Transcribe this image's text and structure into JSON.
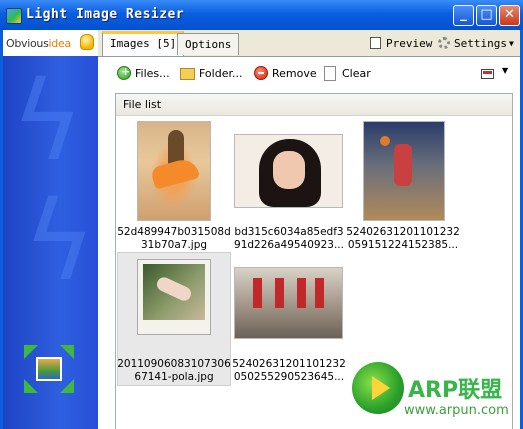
{
  "window": {
    "title": "Light Image Resizer"
  },
  "logo": {
    "text_main": "Obvious",
    "text_accent": "idea"
  },
  "tabs": [
    {
      "label": "Images [5]",
      "active": true
    },
    {
      "label": "Options",
      "active": false
    }
  ],
  "header_links": {
    "preview": "Preview",
    "settings": "Settings"
  },
  "toolbar": {
    "add_files": "Files...",
    "add_folder": "Folder...",
    "remove": "Remove",
    "clear": "Clear"
  },
  "file_list": {
    "title": "File list",
    "items": [
      {
        "line1": "52d489947b031508d",
        "line2": "31b70a7.jpg",
        "selected": false
      },
      {
        "line1": "bd315c6034a85edf3",
        "line2": "91d226a49540923...",
        "selected": false
      },
      {
        "line1": "52402631201101232",
        "line2": "059151224152385...",
        "selected": false
      },
      {
        "line1": "20110906083107306",
        "line2": "67141-pola.jpg",
        "selected": true
      },
      {
        "line1": "52402631201101232",
        "line2": "050255290523645...",
        "selected": false
      }
    ]
  },
  "watermark": {
    "title": "ARP联盟",
    "url": "www.arpun.com"
  },
  "icons": [
    "app-icon",
    "bulb-icon",
    "preview-icon",
    "settings-icon",
    "add-icon",
    "folder-icon",
    "remove-icon",
    "clear-icon",
    "view-icon",
    "resize-logo-icon"
  ]
}
